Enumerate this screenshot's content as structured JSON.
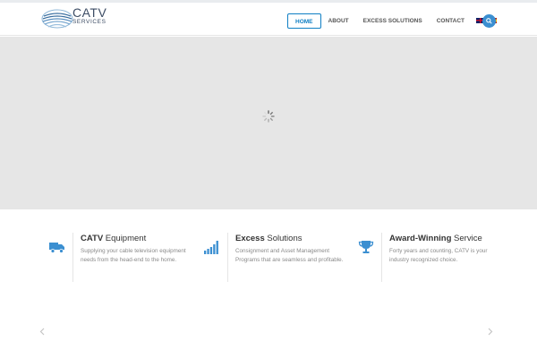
{
  "brand": {
    "logo_line1": "CATV",
    "logo_line2": "SERVICES"
  },
  "nav": {
    "items": [
      {
        "label": "HOME",
        "active": true
      },
      {
        "label": "ABOUT",
        "active": false
      },
      {
        "label": "EXCESS SOLUTIONS",
        "active": false
      },
      {
        "label": "CONTACT",
        "active": false
      }
    ],
    "languages": [
      "uk-flag-icon",
      "spain-flag-icon"
    ],
    "search_icon": "search-icon"
  },
  "hero": {
    "state": "loading",
    "spinner_icon": "loading-spinner-icon"
  },
  "features": [
    {
      "icon": "truck-icon",
      "title_bold": "CATV",
      "title_rest": " Equipment",
      "description": "Supplying your cable television equipment needs from the head-end to the home."
    },
    {
      "icon": "signal-bars-icon",
      "title_bold": "Excess",
      "title_rest": " Solutions",
      "description": "Consignment and Asset Management Programs that are seamless and profitable."
    },
    {
      "icon": "trophy-icon",
      "title_bold": "Award-Winning",
      "title_rest": " Service",
      "description": "Forty years and counting, CATV is your industry recognized choice."
    }
  ],
  "carousel": {
    "prev_icon": "chevron-left-icon",
    "next_icon": "chevron-right-icon"
  },
  "colors": {
    "accent": "#0f7fc4",
    "icon_blue": "#3b8fd1",
    "hero_bg": "#e6e6e6",
    "text_dark": "#333333",
    "text_muted": "#8a8a8a"
  }
}
